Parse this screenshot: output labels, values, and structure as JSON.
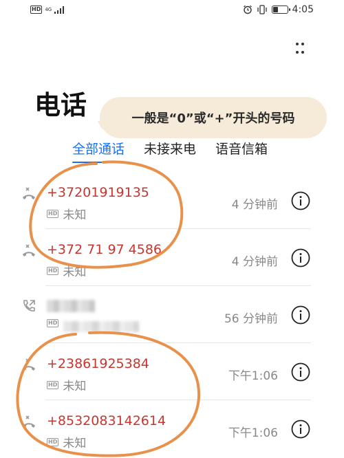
{
  "status_bar": {
    "hd_label": "HD",
    "network_label": "4G",
    "time": "4:05",
    "battery_level": 0.35
  },
  "header": {
    "title": "电话",
    "more_icon": "more-vertical-icon"
  },
  "annotation": {
    "text": "一般是“0”或“+”开头的号码",
    "circle_color": "#e8914a"
  },
  "tabs": [
    {
      "label": "全部通话",
      "active": true
    },
    {
      "label": "未接来电",
      "active": false
    },
    {
      "label": "语音信箱",
      "active": false
    }
  ],
  "calls": [
    {
      "number": "+37201919135",
      "hd_label": "HD",
      "location": "未知",
      "time": "4 分钟前",
      "type": "missed-call-icon"
    },
    {
      "number": "+372 71 97 4586",
      "hd_label": "HD",
      "location": "未知",
      "time": "4 分钟前",
      "type": "missed-call-icon"
    },
    {
      "number": "",
      "hd_label": "HD",
      "location": "",
      "time": "56 分钟前",
      "type": "outgoing-call-icon",
      "redacted": true
    },
    {
      "number": "+23861925384",
      "hd_label": "HD",
      "location": "未知",
      "time": "下午1:06",
      "type": "missed-call-icon"
    },
    {
      "number": "+8532083142614",
      "hd_label": "HD",
      "location": "未知",
      "time": "下午1:06",
      "type": "missed-call-icon"
    }
  ],
  "colors": {
    "accent": "#1a6ff0",
    "missed_number": "#c6362d",
    "secondary_text": "#888888"
  }
}
